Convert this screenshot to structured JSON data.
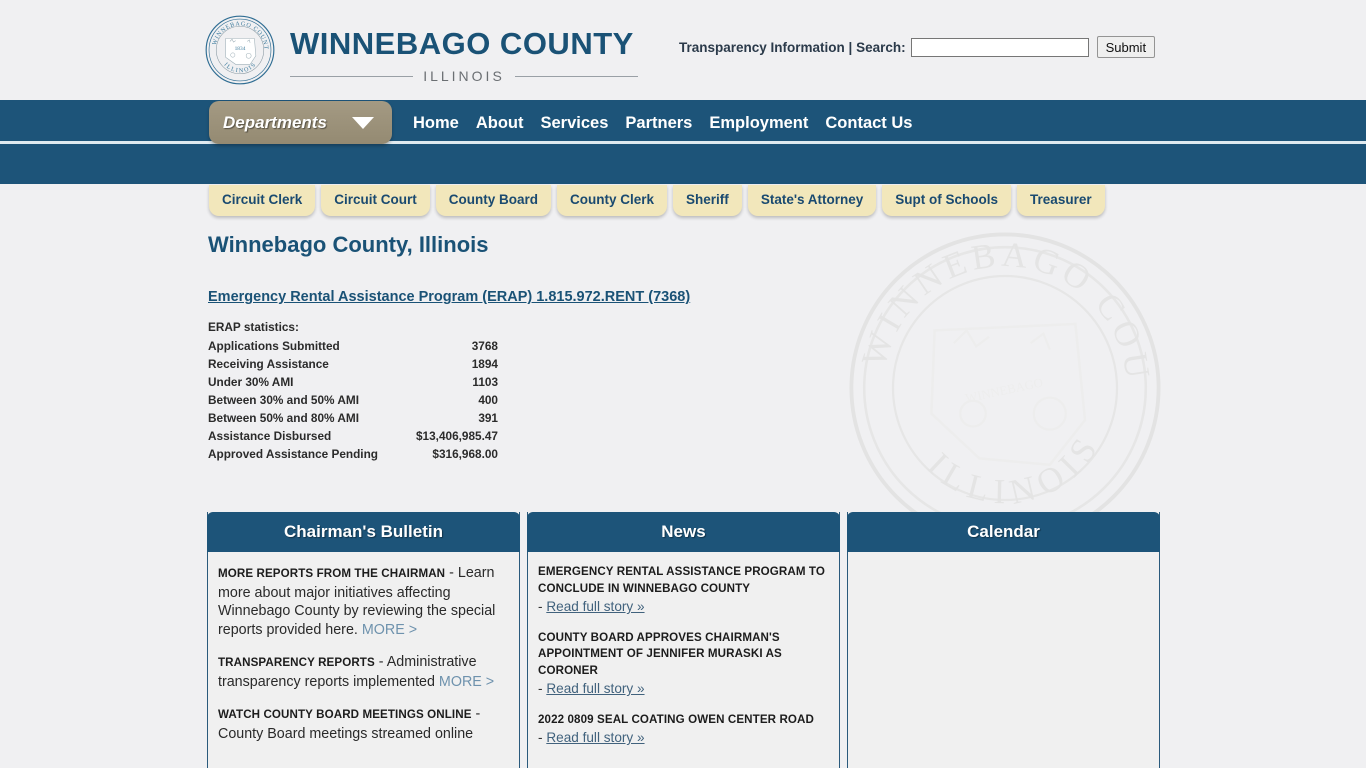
{
  "header": {
    "seal": {
      "outer_text": "WINNEBAGO COUNTY",
      "inner_text": "ILLINOIS",
      "year": "1834"
    },
    "brand_title": "WINNEBAGO COUNTY",
    "brand_subtitle": "ILLINOIS",
    "transparency_text": "Transparency Information | Search:",
    "search_value": "",
    "search_placeholder": "",
    "submit_label": "Submit"
  },
  "nav": {
    "departments_label": "Departments",
    "links": [
      {
        "label": "Home"
      },
      {
        "label": "About"
      },
      {
        "label": "Services"
      },
      {
        "label": "Partners"
      },
      {
        "label": "Employment"
      },
      {
        "label": "Contact Us"
      }
    ]
  },
  "dept_tabs": [
    {
      "label": "Circuit Clerk"
    },
    {
      "label": "Circuit Court"
    },
    {
      "label": "County Board"
    },
    {
      "label": "County Clerk"
    },
    {
      "label": "Sheriff"
    },
    {
      "label": "State's Attorney"
    },
    {
      "label": "Supt of Schools"
    },
    {
      "label": "Treasurer"
    }
  ],
  "main": {
    "page_title": "Winnebago County, Illinois",
    "erap_link": "Emergency Rental Assistance Program (ERAP) 1.815.972.RENT (7368)",
    "erap_caption": "ERAP statistics:",
    "erap_rows": [
      {
        "label": "Applications Submitted",
        "value": "3768"
      },
      {
        "label": "Receiving Assistance",
        "value": "1894"
      },
      {
        "label": "Under 30% AMI",
        "value": "1103"
      },
      {
        "label": "Between 30% and 50% AMI",
        "value": "400"
      },
      {
        "label": "Between 50% and 80% AMI",
        "value": "391"
      },
      {
        "label": "Assistance Disbursed",
        "value": "$13,406,985.47"
      },
      {
        "label": "Approved Assistance Pending",
        "value": "$316,968.00"
      }
    ]
  },
  "panels": {
    "bulletin": {
      "title": "Chairman's Bulletin",
      "items": [
        {
          "head": "MORE REPORTS FROM THE CHAIRMAN",
          "dash": " - ",
          "text": "Learn more about major initiatives affecting Winnebago County by reviewing the special reports provided here. ",
          "more": "MORE >"
        },
        {
          "head": "TRANSPARENCY REPORTS",
          "dash": " - ",
          "text": "Administrative transparency reports implemented ",
          "more": "MORE >"
        },
        {
          "head": "WATCH COUNTY BOARD MEETINGS ONLINE",
          "dash": " - ",
          "text": "County Board meetings streamed online",
          "more": ""
        }
      ]
    },
    "news": {
      "title": "News",
      "items": [
        {
          "head": "EMERGENCY RENTAL ASSISTANCE PROGRAM TO CONCLUDE IN WINNEBAGO COUNTY",
          "dash": "- ",
          "link": "Read full story »"
        },
        {
          "head": "COUNTY BOARD APPROVES CHAIRMAN'S APPOINTMENT OF JENNIFER MURASKI AS CORONER",
          "dash": "- ",
          "link": "Read full story »"
        },
        {
          "head": "2022 0809 SEAL COATING OWEN CENTER ROAD",
          "dash": "- ",
          "link": "Read full story »"
        }
      ]
    },
    "calendar": {
      "title": "Calendar",
      "body": ""
    }
  },
  "colors": {
    "nav_blue": "#1d5479",
    "brand_blue": "#1a5276",
    "tab_cream": "#f2e7bb",
    "dept_tan": "#948a72",
    "page_bg": "#f0f0f2"
  }
}
